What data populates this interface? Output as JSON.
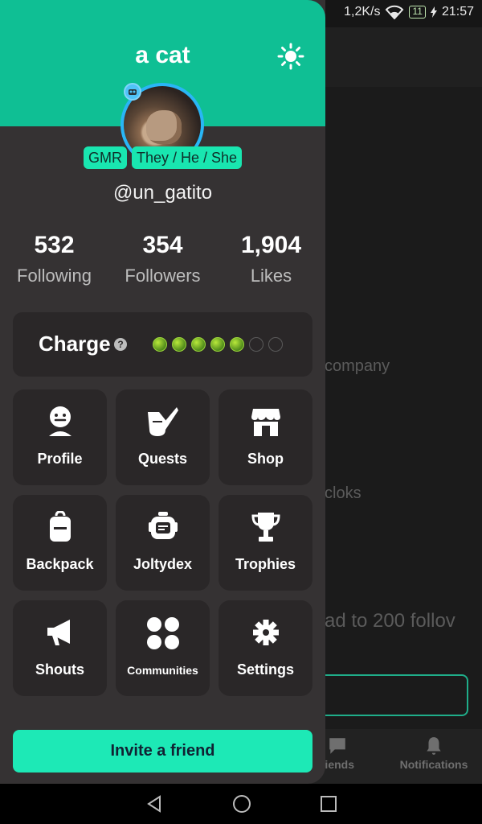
{
  "status_bar": {
    "network_speed": "1,2K/s",
    "battery": "11",
    "time": "21:57"
  },
  "drawer": {
    "title": "a cat",
    "badges": [
      "GMR",
      "They / He / She"
    ],
    "username": "@un_gatito",
    "stats": [
      {
        "value": "532",
        "label": "Following"
      },
      {
        "value": "354",
        "label": "Followers"
      },
      {
        "value": "1,904",
        "label": "Likes"
      }
    ],
    "charge": {
      "label": "Charge",
      "help": "?",
      "filled": 5,
      "total": 7
    },
    "tiles": [
      {
        "label": "Profile",
        "icon": "face-icon"
      },
      {
        "label": "Quests",
        "icon": "quill-icon"
      },
      {
        "label": "Shop",
        "icon": "store-icon"
      },
      {
        "label": "Backpack",
        "icon": "backpack-icon"
      },
      {
        "label": "Joltydex",
        "icon": "robot-icon"
      },
      {
        "label": "Trophies",
        "icon": "trophy-icon"
      },
      {
        "label": "Shouts",
        "icon": "megaphone-icon"
      },
      {
        "label": "Communities",
        "icon": "communities-icon"
      },
      {
        "label": "Settings",
        "icon": "gear-icon"
      }
    ],
    "invite_label": "Invite a friend"
  },
  "background": {
    "texts": [
      "company",
      "cloks",
      "ad to 200 follov"
    ],
    "nav": [
      {
        "label": "riends",
        "icon": "chat-icon"
      },
      {
        "label": "Notifications",
        "icon": "bell-icon"
      }
    ]
  },
  "colors": {
    "accent": "#0fbf94",
    "button": "#1de9b6",
    "panel": "#353233",
    "tile": "#2a2728",
    "avatar_ring": "#29b6f6"
  }
}
